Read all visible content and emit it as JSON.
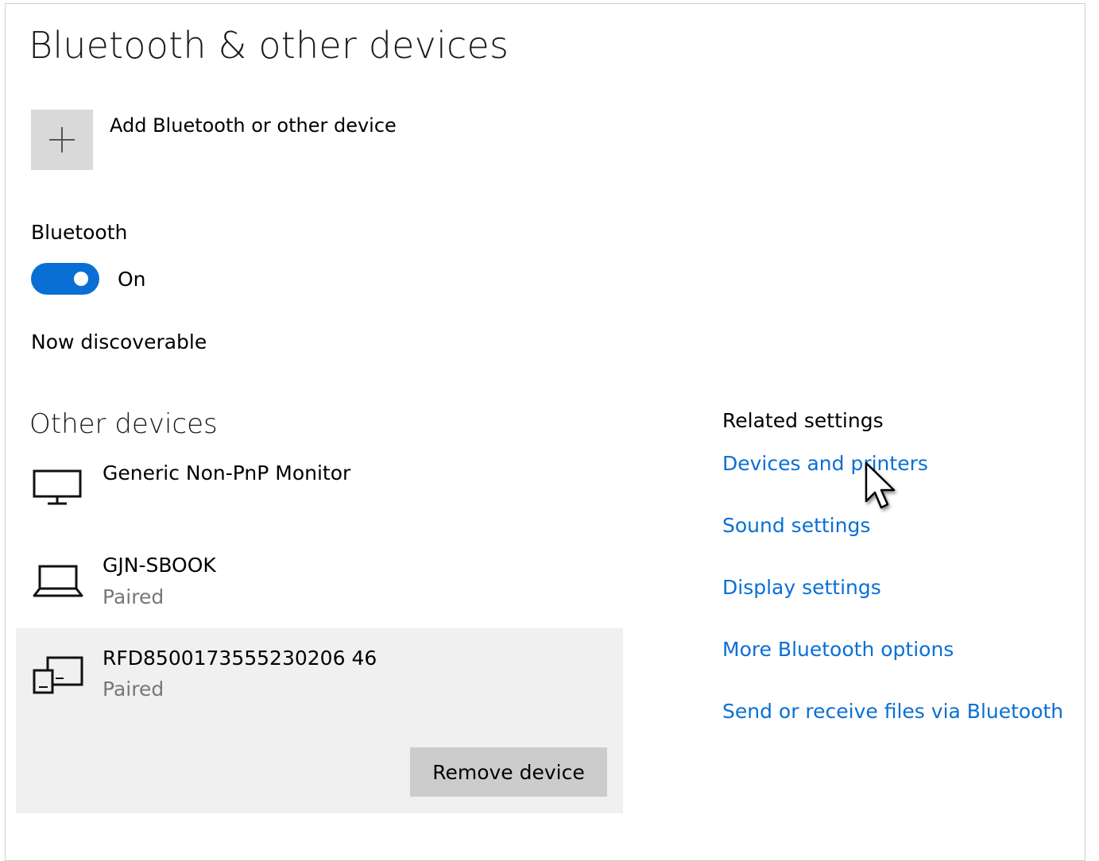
{
  "header": {
    "title": "Bluetooth & other devices"
  },
  "add_device": {
    "label": "Add Bluetooth or other device",
    "icon": "plus-icon"
  },
  "bluetooth": {
    "label": "Bluetooth",
    "state_label": "On",
    "enabled": true,
    "discoverable_text": "Now discoverable"
  },
  "other_devices": {
    "title": "Other devices",
    "items": [
      {
        "name": "Generic Non-PnP Monitor",
        "status": "",
        "icon": "monitor-icon"
      },
      {
        "name": "GJN-SBOOK",
        "status": "Paired",
        "icon": "laptop-icon"
      },
      {
        "name": "RFD8500173555230206 46",
        "status": "Paired",
        "icon": "device-icon",
        "selected": true
      }
    ],
    "remove_label": "Remove device"
  },
  "related_settings": {
    "title": "Related settings",
    "links": [
      "Devices and printers",
      "Sound settings",
      "Display settings",
      "More Bluetooth options",
      "Send or receive files via Bluetooth"
    ]
  },
  "colors": {
    "accent": "#0a6fd4",
    "tile": "#d9d9d9",
    "selected_bg": "#f0f0f0",
    "button": "#cccccc"
  }
}
